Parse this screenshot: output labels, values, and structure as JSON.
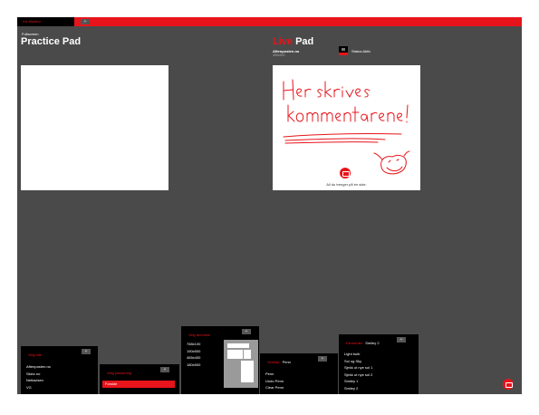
{
  "topbar": {
    "tab_label": "Vis Monitor",
    "plus": "+"
  },
  "practice": {
    "fullscreen_label": "Fullscreen",
    "title": "Practice Pad"
  },
  "live": {
    "title_live": "Live",
    "title_pad": " Pad",
    "site": "Aftenposten.no",
    "size": "465x400",
    "status_label": "Status:Aktiv",
    "caption": "All du trenger på én side."
  },
  "panels": {
    "sites": {
      "title": "Velg site",
      "plus": "+",
      "items": [
        "Aftenposten.no",
        "Skiez.no",
        "Nettavisen",
        "VG"
      ]
    },
    "placement": {
      "title": "Velg plassering",
      "plus": "+",
      "items": [
        "Forside"
      ]
    },
    "format": {
      "title": "Velg annonse",
      "plus": "+",
      "items": [
        "768x100",
        "150x500",
        "465x400",
        "180x500"
      ]
    },
    "pen": {
      "title_red": "Verktøy",
      "title_white": "Penn",
      "plus": "+",
      "items": [
        "Penn",
        "Undo Penn",
        "Clear Penn"
      ]
    },
    "elements": {
      "title_red": "Elementer",
      "title_white": "Smiley 2",
      "plus": "+",
      "items": [
        "Light bulb",
        "Sol og Sky",
        "Sjekk ut nye sol 1",
        "Sjekk ut nye sol 2",
        "Smiley 1",
        "Smiley 2"
      ]
    }
  },
  "colors": {
    "accent": "#e8141b",
    "background": "#4a4a4a",
    "panel": "#000000"
  },
  "icons": {
    "status": "monitor-icon",
    "fab": "camera-icon"
  }
}
